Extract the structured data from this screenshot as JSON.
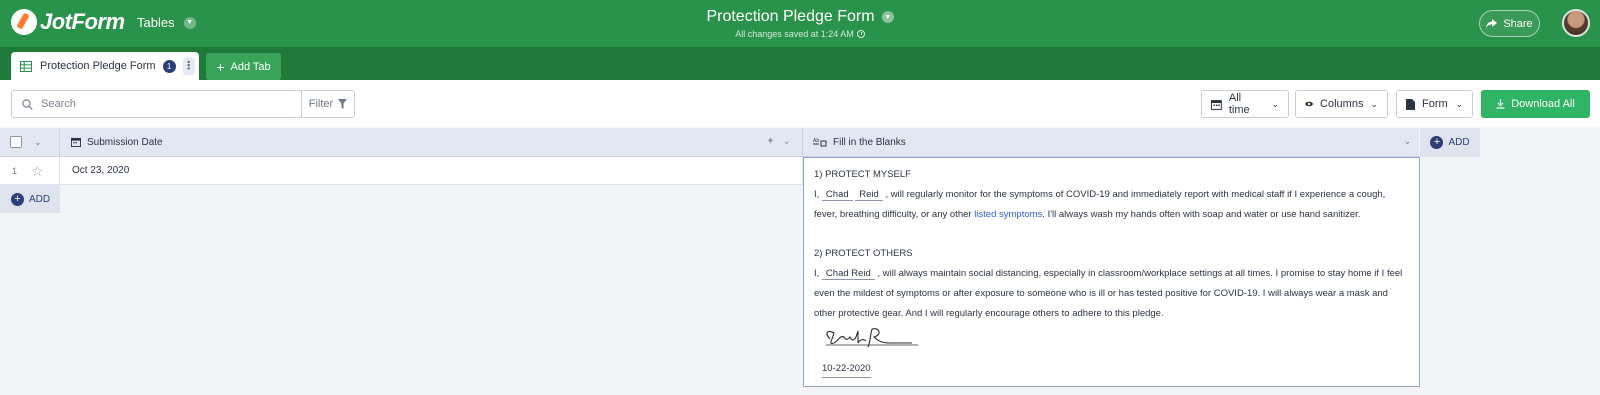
{
  "app": {
    "brand": "JotForm",
    "tables_menu": "Tables",
    "form_title": "Protection Pledge Form",
    "saved_status": "All changes saved at 1:24 AM",
    "share_label": "Share",
    "accent_color": "#2a934b"
  },
  "tabs": {
    "active": {
      "label": "Protection Pledge Form",
      "badge": "1"
    },
    "add_label": "Add Tab"
  },
  "toolbar": {
    "search_placeholder": "Search",
    "filter_label": "Filter",
    "time_label": "All time",
    "columns_label": "Columns",
    "form_label": "Form",
    "download_label": "Download All"
  },
  "table": {
    "columns": [
      {
        "label": "Submission Date",
        "icon": "calendar-icon"
      },
      {
        "label": "Fill in the Blanks",
        "icon": "fill-blanks-icon"
      }
    ],
    "add_column_label": "ADD",
    "add_row_label": "ADD",
    "rows": [
      {
        "number": "1",
        "submission_date": "Oct 23, 2020",
        "fill_in_blanks": {
          "section1_title": "1) PROTECT MYSELF",
          "s1_i": "I,",
          "s1_first": "Chad",
          "s1_last": "Reid",
          "s1_text_a": ", will regularly monitor for the symptoms of COVID-19 and immediately report with medical staff if I experience a cough, fever, breathing difficulty, or any other",
          "s1_link": "listed symptoms",
          "s1_text_b": ". I'll always wash my hands often with soap and water or use hand sanitizer.",
          "section2_title": "2) PROTECT OTHERS",
          "s2_i": "I,",
          "s2_name": "Chad Reid",
          "s2_text": ", will always maintain social distancing, especially in classroom/workplace settings at all times. I promise to stay home if I feel even the mildest of symptoms or after exposure to someone who is ill or has tested positive for COVID-19. I will always wear a mask and other protective gear. And I will regularly encourage others to adhere to this pledge.",
          "date": "10-22-2020"
        }
      }
    ]
  }
}
